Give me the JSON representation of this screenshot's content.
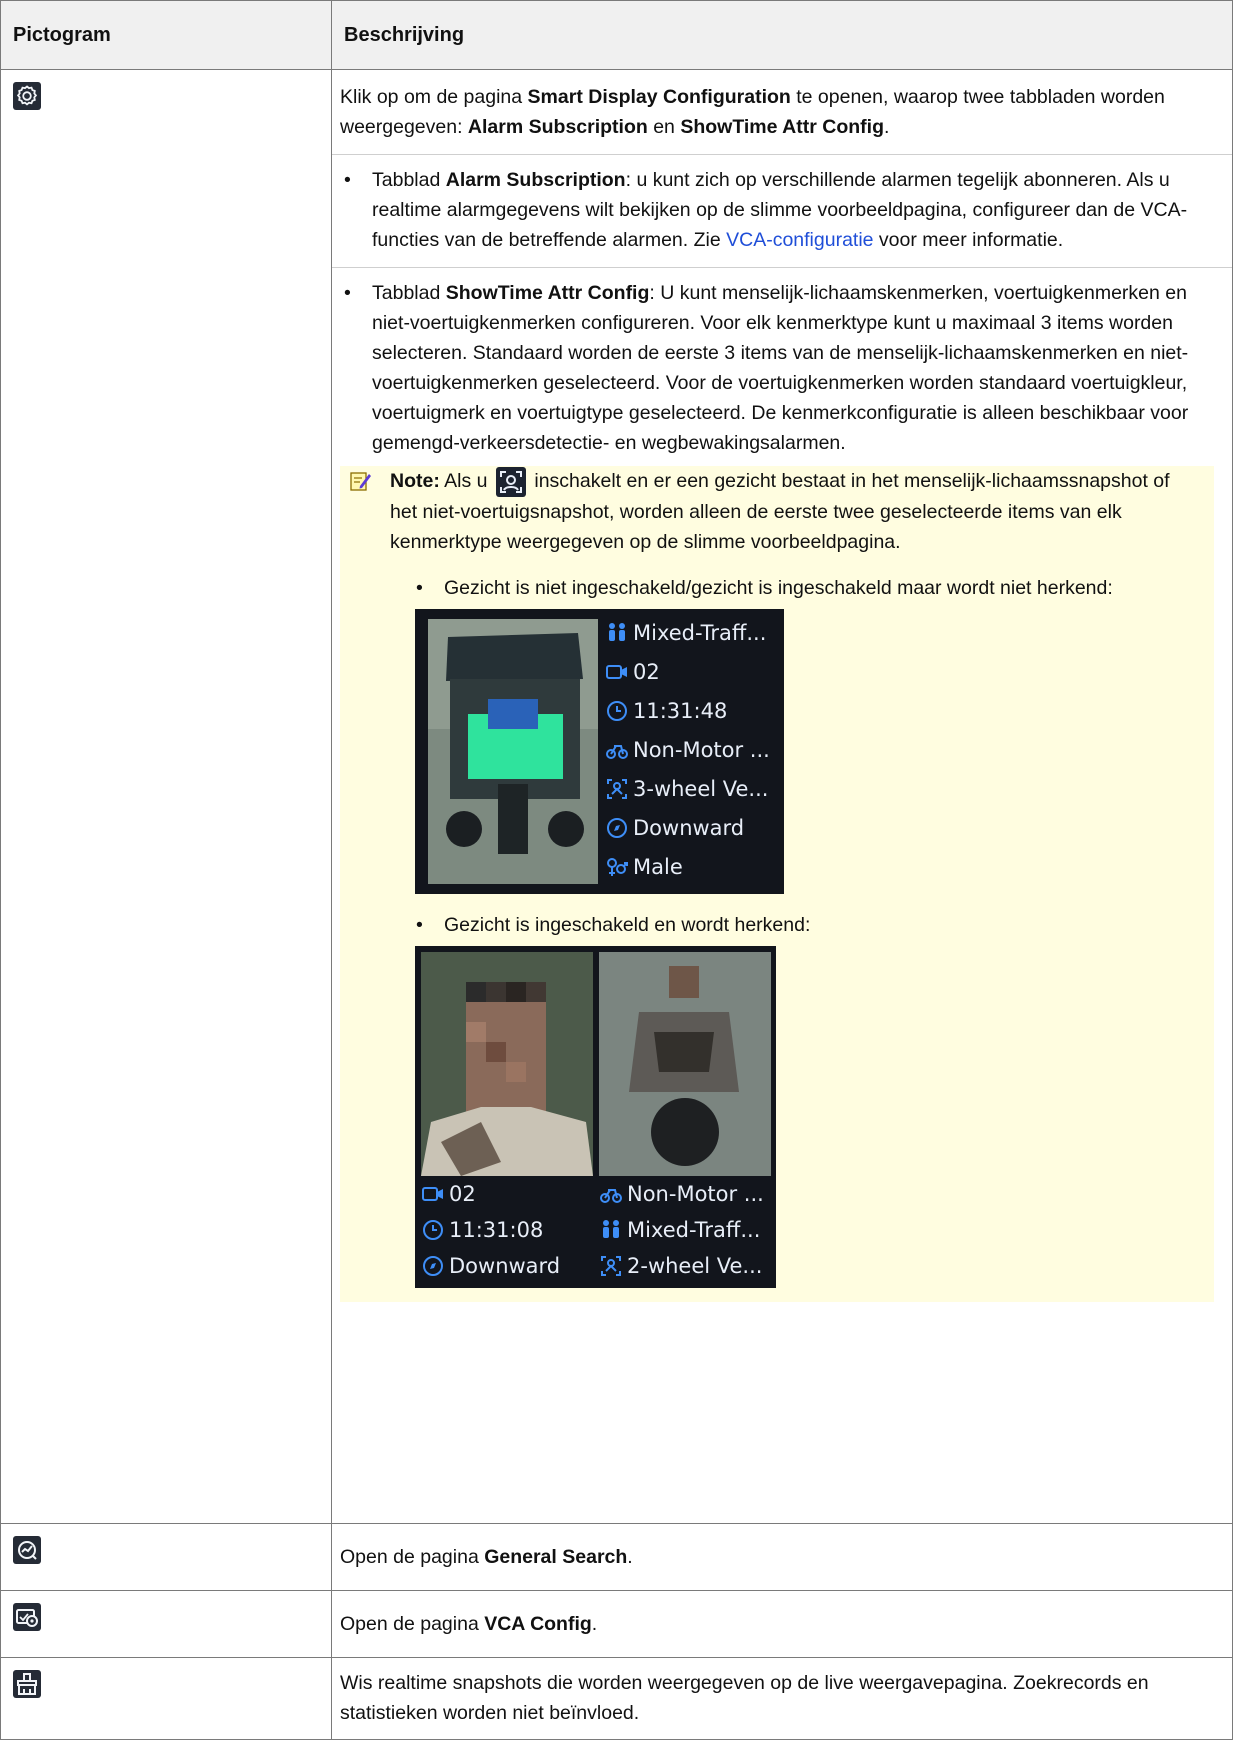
{
  "table": {
    "headers": [
      "Pictogram",
      "Beschrijving"
    ],
    "rows": [
      {
        "icon": "gear-icon",
        "intro": {
          "t1": "Klik op om de pagina ",
          "b1": "Smart Display Configuration",
          "t2": " te openen, waarop twee tabbladen worden weergegeven: ",
          "b2": "Alarm Subscription",
          "t3": " en ",
          "b3": "ShowTime Attr Config",
          "t4": "."
        },
        "bullet1": {
          "t1": "Tabblad ",
          "b1": "Alarm Subscription",
          "t2": ": u kunt zich op verschillende alarmen tegelijk abonneren. Als u realtime alarmgegevens wilt bekijken op de slimme voorbeeldpagina, configureer dan de VCA-functies van de betreffende alarmen. Zie ",
          "link": "VCA-configuratie",
          "t3": " voor meer informatie."
        },
        "bullet2": {
          "t1": "Tabblad ",
          "b1": "ShowTime Attr Config",
          "t2": ": U kunt menselijk-lichaamskenmerken, voertuigkenmerken en niet-voertuigkenmerken configureren. Voor elk kenmerktype kunt u maximaal 3 items worden selecteren. Standaard worden de eerste 3 items van de menselijk-lichaamskenmerken en niet-voertuigkenmerken geselecteerd. Voor de voertuigkenmerken worden standaard voertuigkleur, voertuigmerk en voertuigtype geselecteerd. De kenmerkconfiguratie is alleen beschikbaar voor gemengd-verkeersdetectie- en wegbewakingsalarmen."
        },
        "note": {
          "label": "Note:",
          "t1": " Als u ",
          "t2": " inschakelt en er een gezicht bestaat in het menselijk-lichaamssnapshot of het niet-voertuigsnapshot, worden alleen de eerste twee geselecteerde items van elk kenmerktype weergegeven op de slimme voorbeeldpagina.",
          "sub1": "Gezicht is niet ingeschakeld/gezicht is ingeschakeld maar wordt niet herkend:",
          "sub2": "Gezicht is ingeschakeld en wordt herkend:"
        },
        "screen1": {
          "attrs": [
            "Mixed-Traff...",
            "02",
            "11:31:48",
            "Non-Motor ...",
            "3-wheel Ve...",
            "Downward",
            "Male"
          ]
        },
        "screen2": {
          "left_attrs": [
            "02",
            "11:31:08",
            "Downward"
          ],
          "right_attrs": [
            "Non-Motor ...",
            "Mixed-Traff...",
            "2-wheel Ve..."
          ]
        }
      },
      {
        "icon": "search-chart-icon",
        "t1": "Open de pagina ",
        "b1": "General Search",
        "t2": "."
      },
      {
        "icon": "vca-config-icon",
        "t1": "Open de pagina ",
        "b1": "VCA Config",
        "t2": "."
      },
      {
        "icon": "clear-icon",
        "text": "Wis realtime snapshots die worden weergegeven op de live weergavepagina. Zoekrecords en statistieken worden niet beïnvloed."
      }
    ]
  }
}
